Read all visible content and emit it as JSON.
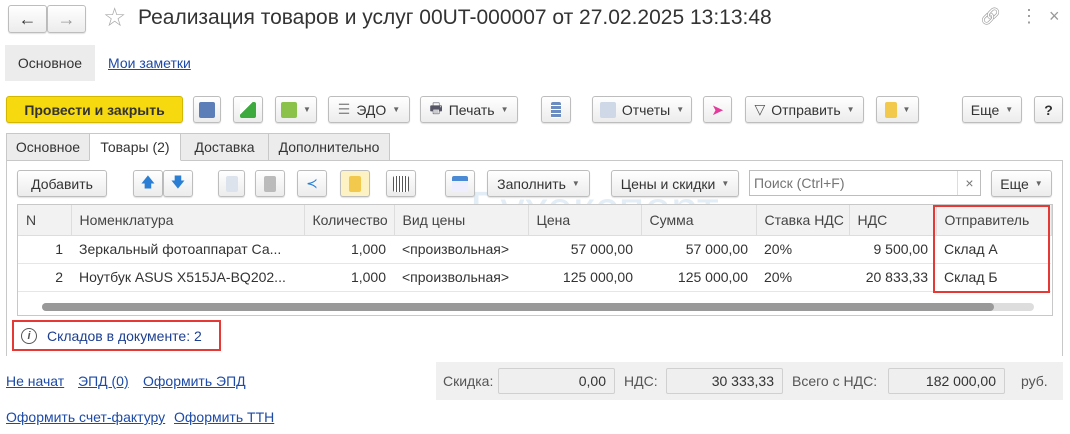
{
  "window": {
    "title": "Реализация товаров и услуг 00UT-000007 от 27.02.2025 13:13:48"
  },
  "sections": {
    "main": "Основное",
    "notes": "Мои заметки"
  },
  "toolbar": {
    "post_close": "Провести и закрыть",
    "edo": "ЭДО",
    "print": "Печать",
    "reports": "Отчеты",
    "send": "Отправить",
    "more": "Еще",
    "help": "?"
  },
  "tabs": [
    "Основное",
    "Товары (2)",
    "Доставка",
    "Дополнительно"
  ],
  "items_toolbar": {
    "add": "Добавить",
    "fill": "Заполнить",
    "prices": "Цены и скидки",
    "search_placeholder": "Поиск (Ctrl+F)",
    "clear": "×",
    "more": "Еще"
  },
  "table": {
    "columns": [
      "N",
      "Номенклатура",
      "Количество",
      "Вид цены",
      "Цена",
      "Сумма",
      "Ставка НДС",
      "НДС",
      "Отправитель"
    ],
    "rows": [
      [
        "1",
        "Зеркальный фотоаппарат Са...",
        "1,000",
        "<произвольная>",
        "57 000,00",
        "57 000,00",
        "20%",
        "9 500,00",
        "Склад А"
      ],
      [
        "2",
        "Ноутбук ASUS X515JA-BQ202...",
        "1,000",
        "<произвольная>",
        "125 000,00",
        "125 000,00",
        "20%",
        "20 833,33",
        "Склад Б"
      ]
    ]
  },
  "info": {
    "text": "Складов в документе: 2"
  },
  "footer": {
    "links1": [
      "Не начат",
      "ЭПД (0)",
      "Оформить ЭПД"
    ],
    "links2": [
      "Оформить счет-фактуру",
      "Оформить ТТН"
    ],
    "discount_label": "Скидка:",
    "discount": "0,00",
    "vat_label": "НДС:",
    "vat": "30 333,33",
    "total_label": "Всего с НДС:",
    "total": "182 000,00",
    "currency": "руб."
  },
  "watermark": "Бухэксперт",
  "colors": {
    "primary": "#f7d910",
    "link": "#1d4aa6",
    "highlight": "#e53935"
  }
}
